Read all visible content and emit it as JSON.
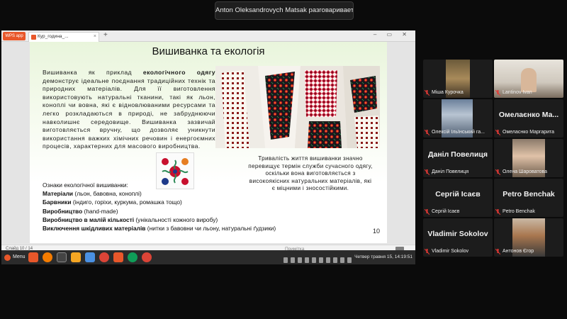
{
  "meeting": {
    "speaking_banner": "Anton Oleksandrovych Matsak разговаривает..."
  },
  "wps": {
    "home_tab": "WPS app",
    "doc_tab": "Кур_година_... ишанка_2025",
    "close_x": "×",
    "new_tab": "+",
    "window_controls": "–  ▭  ✕"
  },
  "slide": {
    "title": "Вишиванка та екологія",
    "intro_lead": "Вишиванка як приклад ",
    "intro_bold": "екологічного одягу",
    "intro_rest": " демонструє ідеальне поєднання традиційних технік та природних матеріалів. Для її виготовлення використовують натуральні тканини, такі як льон, коноплі чи вовна, які є відновлюваними ресурсами та легко розкладаються в природі, не забруднюючи навколишнє середовище. Вишиванка зазвичай виготовляється вручну, що дозволяє уникнути використання важких хімічних речовин і енергоємних процесів, характерних для масового виробництва.",
    "features_head": "Ознаки екологічної вишиванки:",
    "features": [
      {
        "bold": "Матеріали",
        "text": " (льон, бавовна, коноплі)"
      },
      {
        "bold": "Барвники",
        "text": " (індиго, горіхи, куркума, ромашка тощо)"
      },
      {
        "bold": "Виробництво",
        "text": " (hand-made)"
      },
      {
        "bold": "Виробництво в малій кількості",
        "text": " (унікальності кожного виробу)"
      },
      {
        "bold": "Виключення шкідливих матеріалів",
        "text": " (нитки з бавовни чи льону, натуральні ґудзики)"
      }
    ],
    "lifetime": "Тривалість життя вишиванки значно перевищує термін служби сучасного одягу, оскільки вона виготовляється з високоякісних натуральних матеріалів, які є міцними і зносостійкими.",
    "page_number": "10"
  },
  "statusbar": {
    "slide_count": "Слайд 10 / 14",
    "notes": "Примітка"
  },
  "taskbar": {
    "menu_label": "Menu",
    "tray_text": "Четвер травня 15, 14:19:51"
  },
  "participants": [
    {
      "name": "Міша Курочка",
      "display": ""
    },
    {
      "name": "Lantinov Ivan",
      "display": ""
    },
    {
      "name": "Олексій Ільїнський га...",
      "display": ""
    },
    {
      "name": "Омеласнко Маргарита",
      "display": "Омелаєнко Ма..."
    },
    {
      "name": "Даніл Повелиця",
      "display": "Даніл Повелиця"
    },
    {
      "name": "Олена Шароватова",
      "display": ""
    },
    {
      "name": "Сергій Ісаєв",
      "display": "Сергій Ісаєв"
    },
    {
      "name": "Petro Benchak",
      "display": "Petro Benchak"
    },
    {
      "name": "Vladimir Sokolov",
      "display": "Vladimir Sokolov"
    },
    {
      "name": "Антонов Єгор",
      "display": ""
    }
  ],
  "colors": {
    "muted_mic": "#e53935",
    "wps_accent": "#e8572a"
  }
}
